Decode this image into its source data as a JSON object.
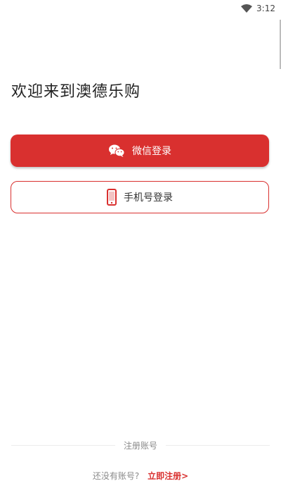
{
  "status_bar": {
    "time": "3:12",
    "wifi_icon": "wifi-icon"
  },
  "welcome_title": "欢迎来到澳德乐购",
  "buttons": {
    "wechat_login": {
      "label": "微信登录",
      "icon": "wechat-icon",
      "color": "#d9302f"
    },
    "phone_login": {
      "label": "手机号登录",
      "icon": "phone-icon",
      "color": "#d9302f"
    }
  },
  "register": {
    "divider_label": "注册账号",
    "hint": "还没有账号?",
    "link": "立即注册>"
  },
  "colors": {
    "accent": "#d9302f",
    "text": "#222222",
    "muted": "#8a8a8a"
  }
}
